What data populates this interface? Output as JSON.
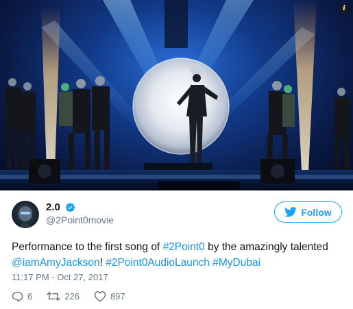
{
  "media": {
    "info_badge": "i",
    "description_icon": "concert-stage-photo"
  },
  "author": {
    "display_name": "2.0",
    "handle": "@2Point0movie",
    "verified": true
  },
  "follow_button": {
    "label": "Follow",
    "icon": "twitter-bird-icon"
  },
  "tweet": {
    "segments": [
      {
        "text": "Performance to the first song of ",
        "type": "text"
      },
      {
        "text": "#2Point0",
        "type": "link"
      },
      {
        "text": " by the amazingly talented ",
        "type": "text"
      },
      {
        "text": "@iamAmyJackson",
        "type": "link"
      },
      {
        "text": "! ",
        "type": "text"
      },
      {
        "text": "#2Point0AudioLaunch",
        "type": "link"
      },
      {
        "text": " ",
        "type": "text"
      },
      {
        "text": "#MyDubai",
        "type": "link"
      }
    ]
  },
  "timestamp": "11:17 PM - Oct 27, 2017",
  "actions": {
    "reply_count": "6",
    "retweet_count": "226",
    "like_count": "897"
  },
  "colors": {
    "link": "#1b95e0",
    "brand": "#1da1f2",
    "secondary_text": "#657786"
  }
}
